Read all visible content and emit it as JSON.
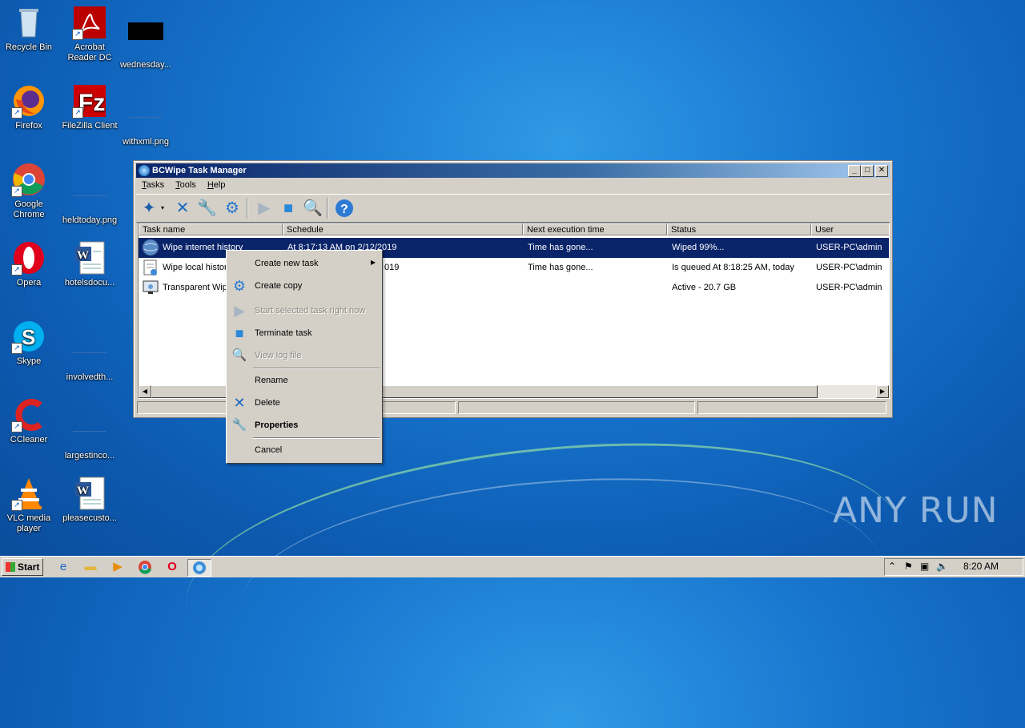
{
  "desktop": {
    "icons": [
      {
        "label": "Recycle Bin"
      },
      {
        "label": "Acrobat\nReader DC"
      },
      {
        "label": "wednesday..."
      },
      {
        "label": "Firefox"
      },
      {
        "label": "FileZilla Client"
      },
      {
        "label": "withxml.png"
      },
      {
        "label": "Google\nChrome"
      },
      {
        "label": "heldtoday.png"
      },
      {
        "label": "Opera"
      },
      {
        "label": "hotelsdocu..."
      },
      {
        "label": "Skype"
      },
      {
        "label": "involvedth..."
      },
      {
        "label": "CCleaner"
      },
      {
        "label": "largestinco..."
      },
      {
        "label": "VLC media\nplayer"
      },
      {
        "label": "pleasecusto..."
      }
    ]
  },
  "window": {
    "title": "BCWipe Task Manager",
    "menu": [
      "Tasks",
      "Tools",
      "Help"
    ],
    "columns": [
      "Task name",
      "Schedule",
      "Next execution time",
      "Status",
      "User"
    ],
    "rows": [
      {
        "name": "Wipe internet history",
        "schedule": "At 8:17:13 AM on 2/12/2019",
        "next": "Time has gone...",
        "status": "Wiped 99%...",
        "user": "USER-PC\\admin"
      },
      {
        "name": "Wipe local history",
        "schedule": "019",
        "next": "Time has gone...",
        "status": "Is queued At 8:18:25 AM, today",
        "user": "USER-PC\\admin"
      },
      {
        "name": "Transparent Wip",
        "schedule": "",
        "next": "",
        "status": "Active - 20.7 GB",
        "user": "USER-PC\\admin"
      }
    ]
  },
  "context_menu": {
    "items": [
      {
        "label": "Create new task",
        "icon": "none",
        "disabled": false,
        "submenu": true
      },
      {
        "label": "Create copy",
        "icon": "gear-icon",
        "disabled": false
      },
      {
        "label": "Start selected task right now",
        "icon": "play-icon",
        "disabled": true
      },
      {
        "label": "Terminate task",
        "icon": "stop-icon",
        "disabled": false
      },
      {
        "label": "View log file",
        "icon": "log-icon",
        "disabled": true
      },
      {
        "label": "Rename",
        "icon": "none",
        "disabled": false
      },
      {
        "label": "Delete",
        "icon": "delete-icon",
        "disabled": false
      },
      {
        "label": "Properties",
        "icon": "wrench-icon",
        "disabled": false,
        "bold": true
      },
      {
        "label": "Cancel",
        "icon": "none",
        "disabled": false
      }
    ]
  },
  "taskbar": {
    "start_label": "Start",
    "clock": "8:20 AM"
  },
  "watermark": "ANY RUN"
}
